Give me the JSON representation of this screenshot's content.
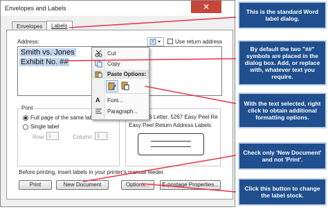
{
  "window": {
    "title": "Envelopes and Labels",
    "close_glyph": "✕"
  },
  "tabs": [
    {
      "label": "Envelopes"
    },
    {
      "label": "Labels",
      "selected": true
    }
  ],
  "address": {
    "label": "Address:",
    "use_return_address_label": "Use return address",
    "lines": [
      "Smith vs. Jones",
      "Exhibit No. ##"
    ]
  },
  "context_menu": {
    "items": [
      {
        "label": "Cut",
        "icon": "scissors-icon"
      },
      {
        "label": "Copy",
        "icon": "copy-icon"
      }
    ],
    "paste_options_label": "Paste Options:",
    "font_label": "Font...",
    "paragraph_label": "Paragraph..."
  },
  "print_group": {
    "label": "Print",
    "full_page_label": "Full page of the same label",
    "single_label": "Single label",
    "row_label": "Row:",
    "row_value": "1",
    "column_label": "Column:",
    "column_value": "1",
    "selected": "full_page"
  },
  "label_group": {
    "line1": "Avery US Letter, 5267 Easy Peel Re",
    "line2": "Easy Peel Return Address Labels"
  },
  "footer_text": "Before printing, insert labels in your printer's manual feeder.",
  "buttons": {
    "print": "Print",
    "new_document": "New Document",
    "options": "Options...",
    "epostage": "E-postage Properties..."
  },
  "callouts": [
    "This is the standard Word label dialog.",
    "By default the two \"##\" symbols are placed in the dialog box. Add, or replace with, whatever text you require.",
    "With the text selected, right click to obtain additional formatting options.",
    "Check only 'New Document' and not 'Print'.",
    "Click this button to change the label stock."
  ],
  "colors": {
    "callout_bg": "#1f4f8f",
    "arrow": "#e8314a",
    "selection": "#bfd4ee",
    "close_button": "#c7453b"
  }
}
